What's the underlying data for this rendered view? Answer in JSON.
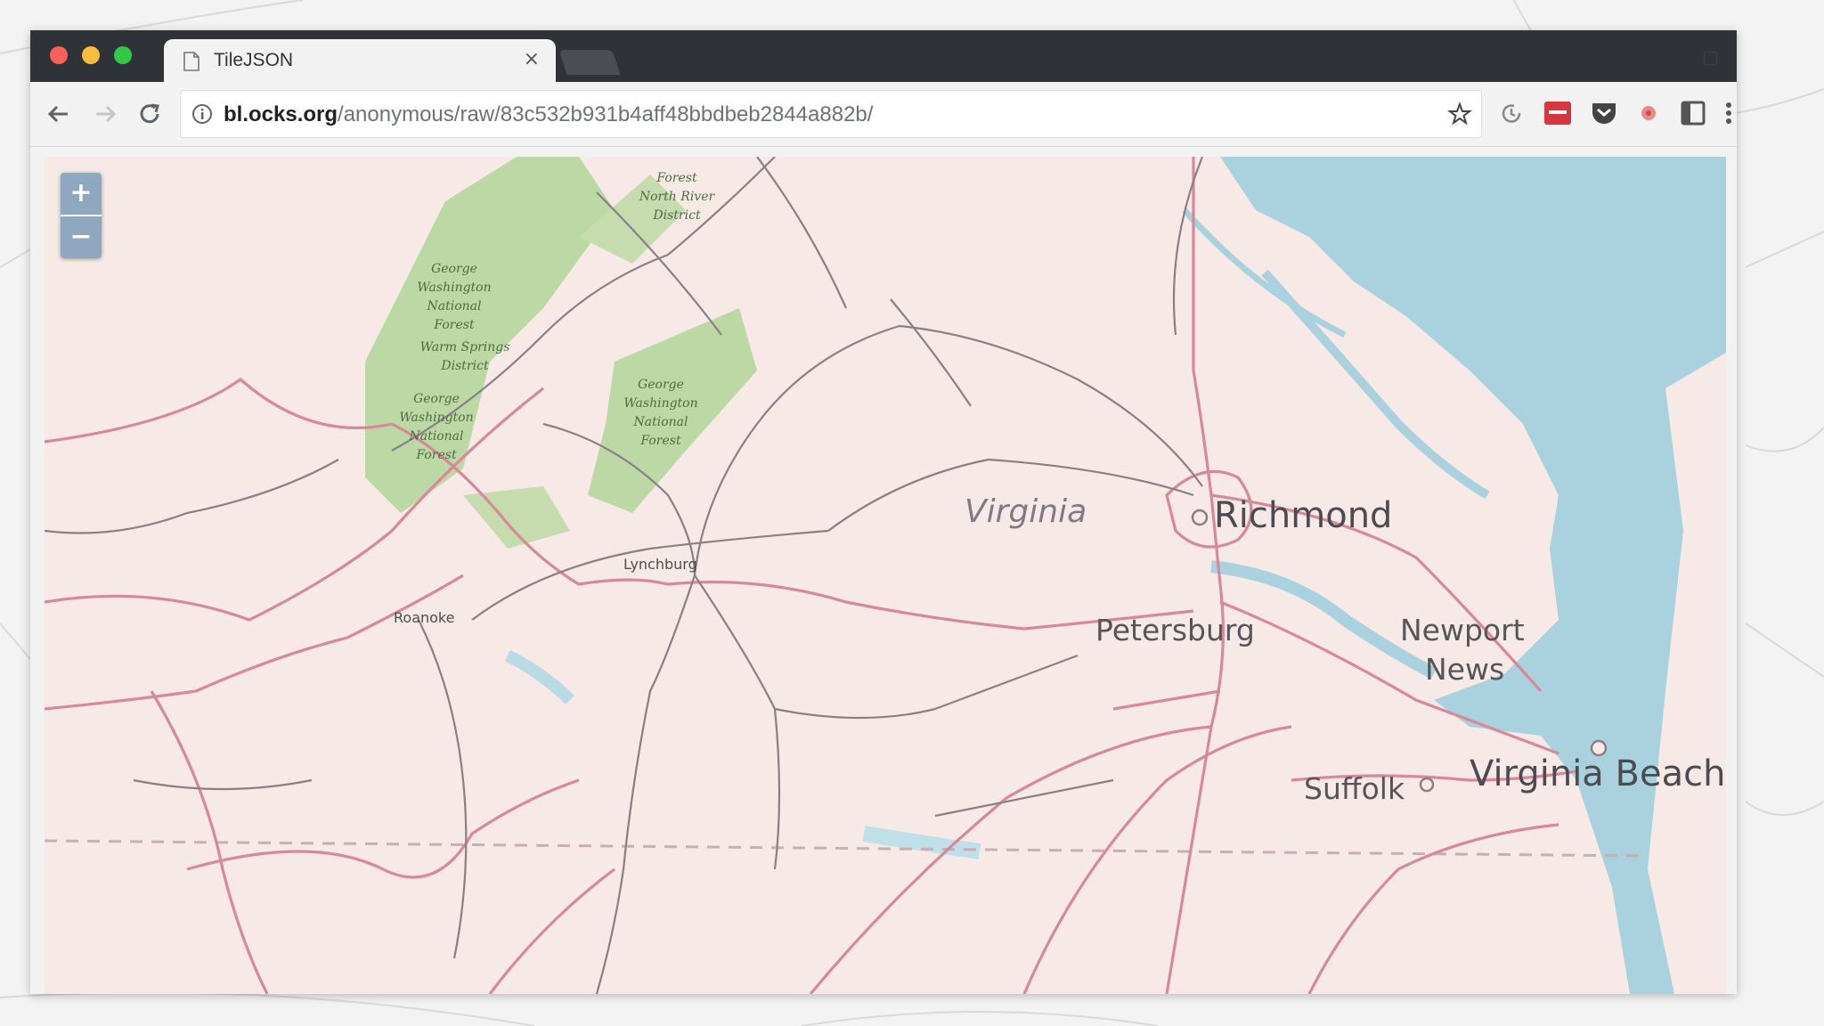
{
  "browser": {
    "tab_title": "TileJSON",
    "tab_close": "×",
    "url_host": "bl.ocks.org",
    "url_path": "/anonymous/raw/83c532b931b4aff48bbdbeb2844a882b/"
  },
  "map": {
    "zoom_in": "+",
    "zoom_out": "−",
    "state_label": "Virginia",
    "cities": {
      "richmond": "Richmond",
      "petersburg": "Petersburg",
      "newport_news_line1": "Newport",
      "newport_news_line2": "News",
      "suffolk": "Suffolk",
      "virginia_beach": "Virginia Beach",
      "lynchburg": "Lynchburg",
      "roanoke": "Roanoke"
    },
    "forests": {
      "gw_north": [
        "George",
        "Washington",
        "National",
        "Forest"
      ],
      "warm_springs": [
        "Warm Springs",
        "District"
      ],
      "gw_south": [
        "George",
        "Washington",
        "National",
        "Forest"
      ],
      "jefferson": [
        "George",
        "Washington",
        "National",
        "Forest"
      ],
      "north_river": [
        "Forest",
        "North River",
        "District"
      ]
    },
    "colors": {
      "land": "#f7e9e5",
      "water": "#a9d2de",
      "forest": "#bcd8a4",
      "road_primary": "#d9879a",
      "road_secondary": "#8a7f86",
      "zoom_control": "#8fa7bf"
    }
  }
}
